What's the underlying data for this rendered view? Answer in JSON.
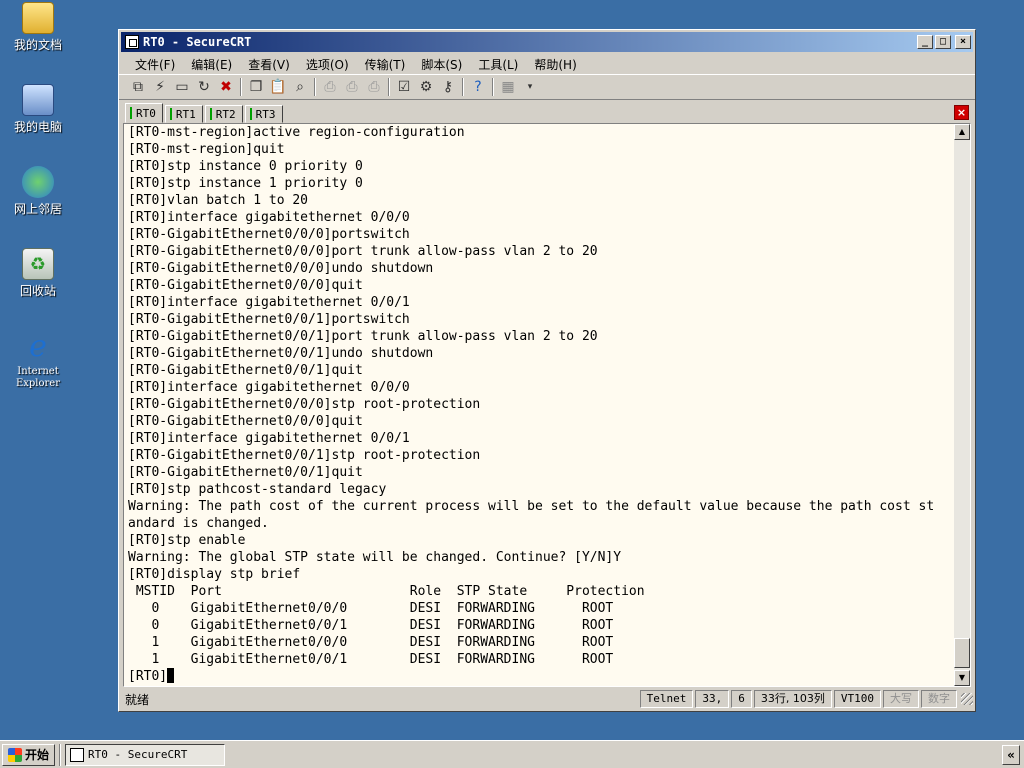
{
  "desktop": {
    "icons": [
      {
        "label": "我的文档",
        "icon": "my-documents-icon"
      },
      {
        "label": "我的电脑",
        "icon": "my-computer-icon"
      },
      {
        "label": "网上邻居",
        "icon": "network-places-icon"
      },
      {
        "label": "回收站",
        "icon": "recycle-bin-icon"
      },
      {
        "label": "Internet Explorer",
        "icon": "internet-explorer-icon"
      }
    ]
  },
  "window": {
    "title": "RT0 - SecureCRT",
    "controls": {
      "minimize": "_",
      "maximize": "□",
      "close": "×"
    },
    "menu": [
      "文件(F)",
      "编辑(E)",
      "查看(V)",
      "选项(O)",
      "传输(T)",
      "脚本(S)",
      "工具(L)",
      "帮助(H)"
    ],
    "toolbar_icons": [
      "connect-icon",
      "quick-connect-icon",
      "connect-in-tab-icon",
      "reconnect-icon",
      "disconnect-icon",
      "copy-icon",
      "paste-icon",
      "find-icon",
      "print-icon",
      "print-selection-icon",
      "print-setup-icon",
      "session-options-icon",
      "global-options-icon",
      "key-icon",
      "help-icon",
      "keymap-icon"
    ],
    "tabs": [
      {
        "label": "RT0",
        "active": true
      },
      {
        "label": "RT1",
        "active": false
      },
      {
        "label": "RT2",
        "active": false
      },
      {
        "label": "RT3",
        "active": false
      }
    ],
    "tab_close": "×"
  },
  "terminal": {
    "lines": [
      "[RT0-mst-region]active region-configuration",
      "[RT0-mst-region]quit",
      "[RT0]stp instance 0 priority 0",
      "[RT0]stp instance 1 priority 0",
      "[RT0]vlan batch 1 to 20",
      "[RT0]interface gigabitethernet 0/0/0",
      "[RT0-GigabitEthernet0/0/0]portswitch",
      "[RT0-GigabitEthernet0/0/0]port trunk allow-pass vlan 2 to 20",
      "[RT0-GigabitEthernet0/0/0]undo shutdown",
      "[RT0-GigabitEthernet0/0/0]quit",
      "[RT0]interface gigabitethernet 0/0/1",
      "[RT0-GigabitEthernet0/0/1]portswitch",
      "[RT0-GigabitEthernet0/0/1]port trunk allow-pass vlan 2 to 20",
      "[RT0-GigabitEthernet0/0/1]undo shutdown",
      "[RT0-GigabitEthernet0/0/1]quit",
      "[RT0]interface gigabitethernet 0/0/0",
      "[RT0-GigabitEthernet0/0/0]stp root-protection",
      "[RT0-GigabitEthernet0/0/0]quit",
      "[RT0]interface gigabitethernet 0/0/1",
      "[RT0-GigabitEthernet0/0/1]stp root-protection",
      "[RT0-GigabitEthernet0/0/1]quit",
      "[RT0]stp pathcost-standard legacy",
      "Warning: The path cost of the current process will be set to the default value because the path cost st",
      "andard is changed.",
      "[RT0]stp enable",
      "Warning: The global STP state will be changed. Continue? [Y/N]Y",
      "[RT0]display stp brief",
      " MSTID  Port                        Role  STP State     Protection",
      "   0    GigabitEthernet0/0/0        DESI  FORWARDING      ROOT",
      "   0    GigabitEthernet0/0/1        DESI  FORWARDING      ROOT",
      "   1    GigabitEthernet0/0/0        DESI  FORWARDING      ROOT",
      "   1    GigabitEthernet0/0/1        DESI  FORWARDING      ROOT"
    ],
    "prompt": "[RT0]"
  },
  "statusbar": {
    "ready": "就绪",
    "protocol": "Telnet",
    "row": "33,",
    "col": "6",
    "size": "33行, 103列",
    "emulation": "VT100",
    "caps": "大写",
    "num": "数字"
  },
  "taskbar": {
    "start": "开始",
    "task": "RT0 - SecureCRT",
    "tray_toggle": "«"
  }
}
